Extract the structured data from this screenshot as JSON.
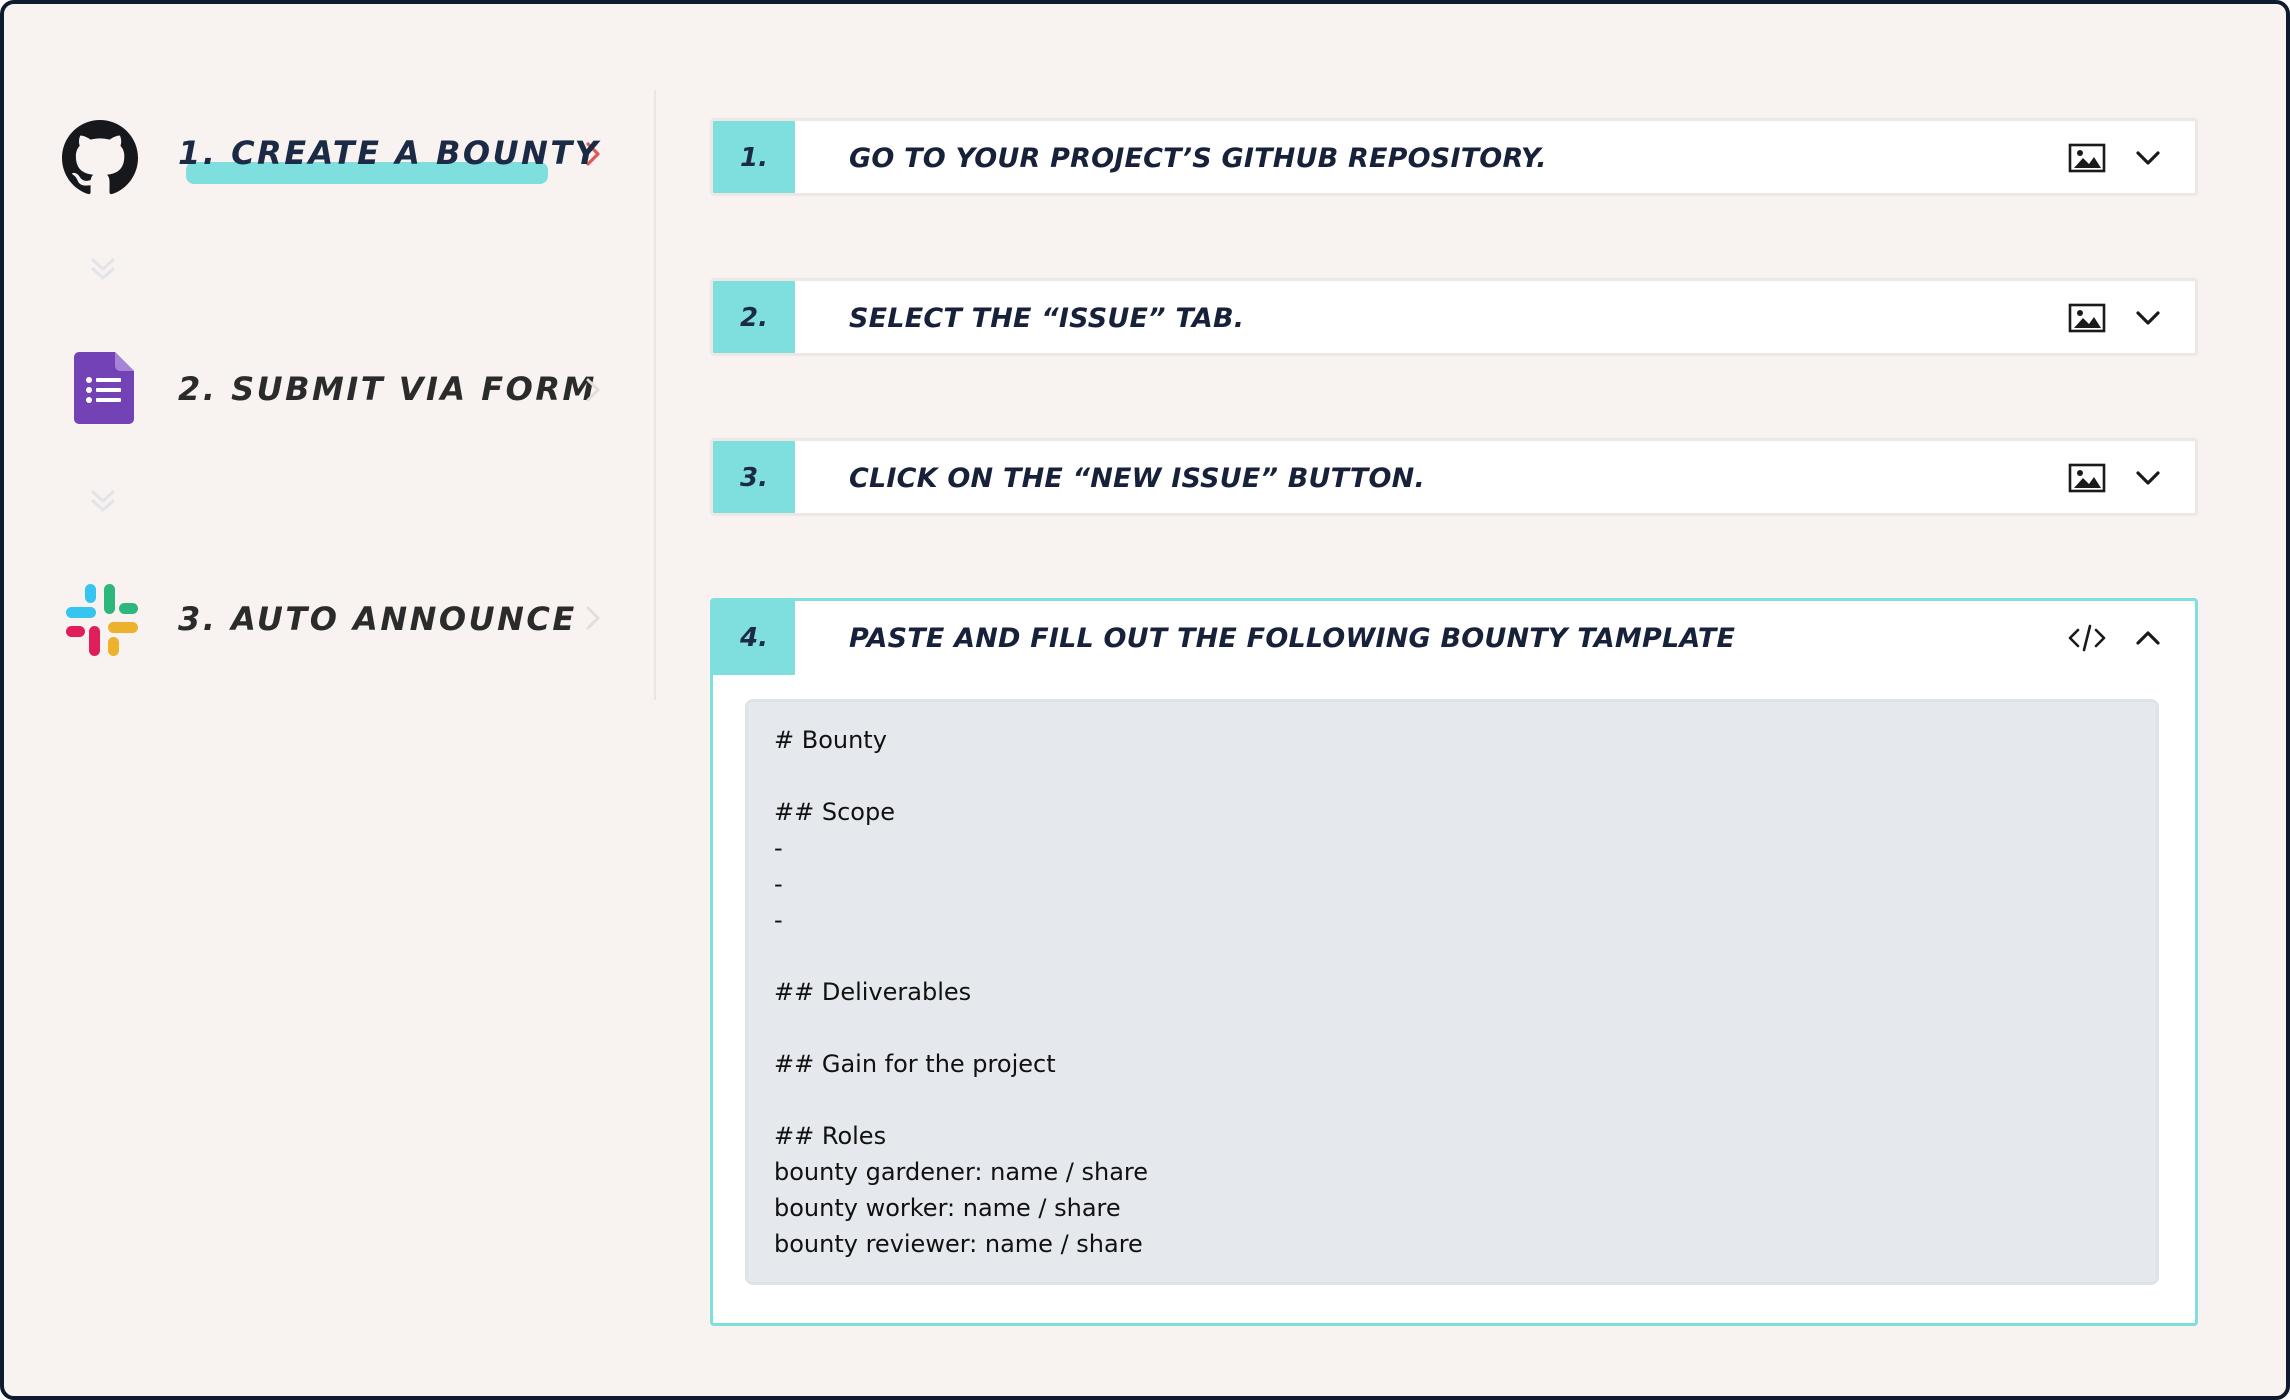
{
  "steps": [
    {
      "number_label": "1. CREATE A BOUNTY",
      "icon": "github-icon",
      "state": "active"
    },
    {
      "number_label": "2. SUBMIT VIA FORM",
      "icon": "google-forms-icon",
      "state": "inactive"
    },
    {
      "number_label": "3. AUTO ANNOUNCE",
      "icon": "slack-icon",
      "state": "inactive"
    }
  ],
  "panels": [
    {
      "number": "1.",
      "title": "GO TO YOUR PROJECT’S GITHUB REPOSITORY.",
      "action_icon": "image-icon",
      "toggle_icon": "chevron-down-icon",
      "expanded": false
    },
    {
      "number": "2.",
      "title": "SELECT THE “ISSUE” TAB.",
      "action_icon": "image-icon",
      "toggle_icon": "chevron-down-icon",
      "expanded": false
    },
    {
      "number": "3.",
      "title": "CLICK ON THE “NEW ISSUE” BUTTON.",
      "action_icon": "image-icon",
      "toggle_icon": "chevron-down-icon",
      "expanded": false
    },
    {
      "number": "4.",
      "title": "PASTE AND FILL OUT THE FOLLOWING BOUNTY TAMPLATE",
      "action_icon": "code-icon",
      "toggle_icon": "chevron-up-icon",
      "expanded": true
    }
  ],
  "template_lines": [
    "# Bounty",
    "",
    "## Scope",
    "-",
    "-",
    "-",
    "",
    "## Deliverables",
    "",
    "## Gain for the project",
    "",
    "## Roles",
    "bounty gardener: name / share",
    "bounty worker: name / share",
    "bounty reviewer: name / share"
  ],
  "colors": {
    "accent": "#7fdede",
    "active_chevron": "#e05a55",
    "inactive_chevron": "#e3dede",
    "background": "#f8f3f1",
    "frame_border": "#0f1a2e",
    "code_background": "#e5e9ed"
  }
}
